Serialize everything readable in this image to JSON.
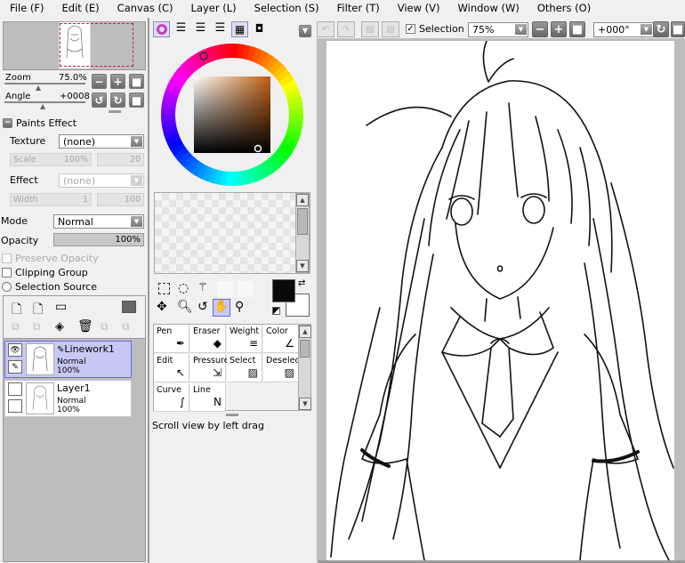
{
  "menu": [
    "File (F)",
    "Edit (E)",
    "Canvas (C)",
    "Layer (L)",
    "Selection (S)",
    "Filter (T)",
    "View (V)",
    "Window (W)",
    "Others (O)"
  ],
  "navigator": {
    "zoom_label": "Zoom",
    "zoom_value": "75.0%",
    "angle_label": "Angle",
    "angle_value": "+0008"
  },
  "paints_effect": {
    "title": "Paints Effect",
    "texture_label": "Texture",
    "texture_value": "(none)",
    "scale_label": "Scale",
    "scale_value": "100%",
    "scale_value2": "20",
    "effect_label": "Effect",
    "effect_value": "(none)",
    "width_label": "Width",
    "width_value": "1",
    "width_value2": "100"
  },
  "layer_props": {
    "mode_label": "Mode",
    "mode_value": "Normal",
    "opacity_label": "Opacity",
    "opacity_value": "100%",
    "opacity_level": 1.0,
    "preserve_opacity": "Preserve Opacity",
    "clipping_group": "Clipping Group",
    "selection_source": "Selection Source"
  },
  "layers": [
    {
      "name": "Linework1",
      "mode": "Normal",
      "opacity": "100%",
      "selected": true
    },
    {
      "name": "Layer1",
      "mode": "Normal",
      "opacity": "100%",
      "selected": false
    }
  ],
  "toolbar": {
    "selection_label": "Selection",
    "selection_checked": true,
    "zoom_value": "75%",
    "rotate_value": "+000°"
  },
  "color": {
    "primary": "#0a0a0a",
    "secondary": "#ffffff",
    "wheel_hue": "#c06010"
  },
  "tools": [
    {
      "name": "Pen",
      "icon": "pen-icon"
    },
    {
      "name": "Eraser",
      "icon": "eraser-icon"
    },
    {
      "name": "Weight",
      "icon": "weight-icon"
    },
    {
      "name": "Color",
      "icon": "color-icon"
    },
    {
      "name": "Edit",
      "icon": "edit-icon"
    },
    {
      "name": "Pressure",
      "icon": "pressure-icon"
    },
    {
      "name": "Select",
      "icon": "select-icon"
    },
    {
      "name": "Deselect",
      "icon": "deselect-icon"
    },
    {
      "name": "Curve",
      "icon": "curve-icon"
    },
    {
      "name": "Line",
      "icon": "line-icon"
    }
  ],
  "status": "Scroll view by left drag"
}
